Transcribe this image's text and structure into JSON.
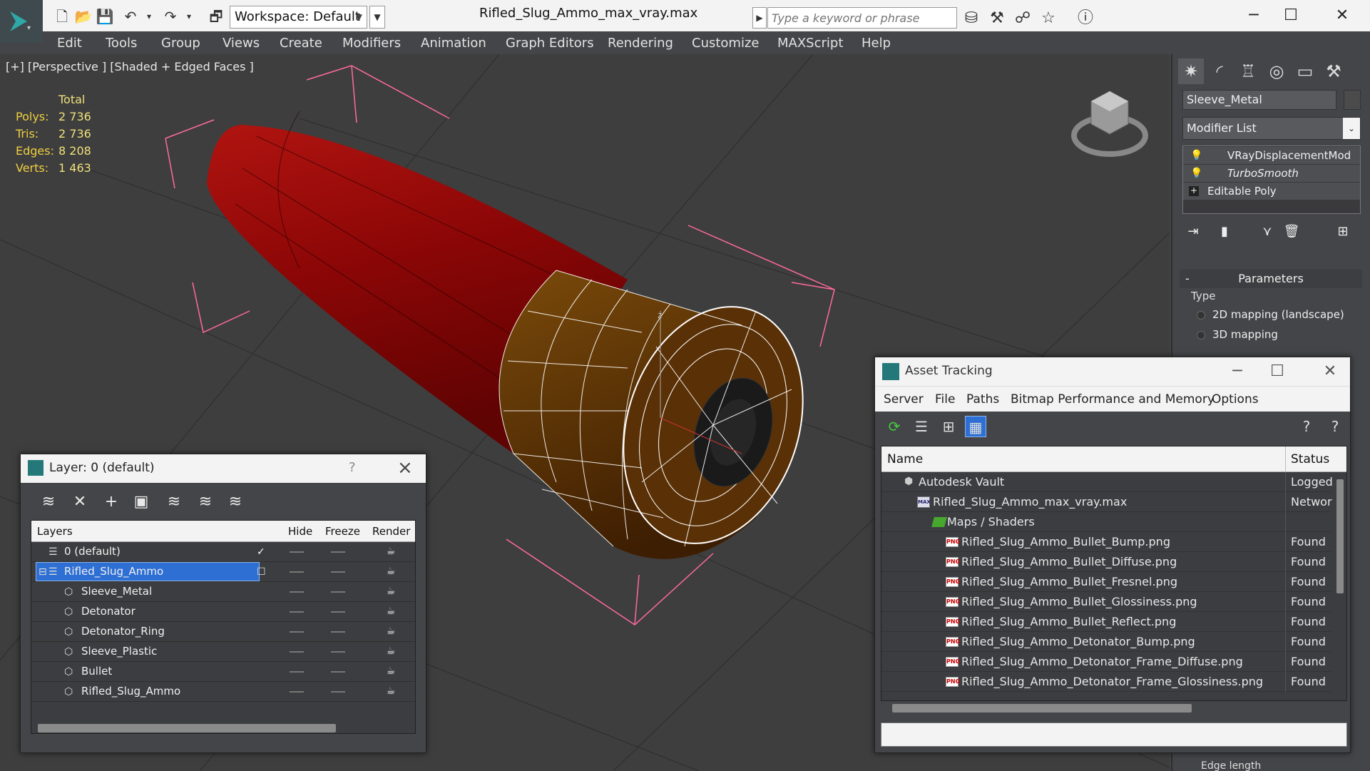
{
  "window": {
    "title": "Rifled_Slug_Ammo_max_vray.max",
    "workspace": "Workspace: Default",
    "search_placeholder": "Type a keyword or phrase"
  },
  "menu": [
    "Edit",
    "Tools",
    "Group",
    "Views",
    "Create",
    "Modifiers",
    "Animation",
    "Graph Editors",
    "Rendering",
    "Customize",
    "MAXScript",
    "Help"
  ],
  "viewport": {
    "label": "[+] [Perspective ] [Shaded + Edged Faces ]",
    "stats": {
      "header": "Total",
      "polys_label": "Polys:",
      "polys": "2 736",
      "tris_label": "Tris:",
      "tris": "2 736",
      "edges_label": "Edges:",
      "edges": "8 208",
      "verts_label": "Verts:",
      "verts": "1 463"
    },
    "colors": {
      "shell_red": "#9a0a08",
      "base_brass": "#6a3a05",
      "wire": "#ffffff",
      "bbox": "#ff6aa0"
    }
  },
  "command_panel": {
    "object_name": "Sleeve_Metal",
    "modifier_list": "Modifier List",
    "stack": [
      "VRayDisplacementMod",
      "TurboSmooth",
      "Editable Poly"
    ],
    "rollout_title": "Parameters",
    "type_label": "Type",
    "options": [
      "2D mapping (landscape)",
      "3D mapping"
    ],
    "edge_length_label": "Edge length"
  },
  "layer_dialog": {
    "title": "Layer: 0 (default)",
    "help": "?",
    "columns": {
      "layers": "Layers",
      "hide": "Hide",
      "freeze": "Freeze",
      "render": "Render"
    },
    "rows": [
      {
        "name": "0 (default)",
        "level": 0
      },
      {
        "name": "Rifled_Slug_Ammo",
        "level": 0,
        "selected": true
      },
      {
        "name": "Sleeve_Metal",
        "level": 1
      },
      {
        "name": "Detonator",
        "level": 1
      },
      {
        "name": "Detonator_Ring",
        "level": 1
      },
      {
        "name": "Sleeve_Plastic",
        "level": 1
      },
      {
        "name": "Bullet",
        "level": 1
      },
      {
        "name": "Rifled_Slug_Ammo",
        "level": 1
      }
    ]
  },
  "asset_dialog": {
    "title": "Asset Tracking",
    "menu": [
      "Server",
      "File",
      "Paths",
      "Bitmap Performance and Memory",
      "Options"
    ],
    "columns": {
      "name": "Name",
      "status": "Status"
    },
    "rows": [
      {
        "name": "Autodesk Vault",
        "status": "Logged",
        "kind": "vault",
        "level": 0
      },
      {
        "name": "Rifled_Slug_Ammo_max_vray.max",
        "status": "Networ",
        "kind": "max",
        "level": 1
      },
      {
        "name": "Maps / Shaders",
        "status": "",
        "kind": "folder",
        "level": 2
      },
      {
        "name": "Rifled_Slug_Ammo_Bullet_Bump.png",
        "status": "Found",
        "kind": "png",
        "level": 3
      },
      {
        "name": "Rifled_Slug_Ammo_Bullet_Diffuse.png",
        "status": "Found",
        "kind": "png",
        "level": 3
      },
      {
        "name": "Rifled_Slug_Ammo_Bullet_Fresnel.png",
        "status": "Found",
        "kind": "png",
        "level": 3
      },
      {
        "name": "Rifled_Slug_Ammo_Bullet_Glossiness.png",
        "status": "Found",
        "kind": "png",
        "level": 3
      },
      {
        "name": "Rifled_Slug_Ammo_Bullet_Reflect.png",
        "status": "Found",
        "kind": "png",
        "level": 3
      },
      {
        "name": "Rifled_Slug_Ammo_Detonator_Bump.png",
        "status": "Found",
        "kind": "png",
        "level": 3
      },
      {
        "name": "Rifled_Slug_Ammo_Detonator_Frame_Diffuse.png",
        "status": "Found",
        "kind": "png",
        "level": 3
      },
      {
        "name": "Rifled_Slug_Ammo_Detonator_Frame_Glossiness.png",
        "status": "Found",
        "kind": "png",
        "level": 3
      }
    ]
  }
}
